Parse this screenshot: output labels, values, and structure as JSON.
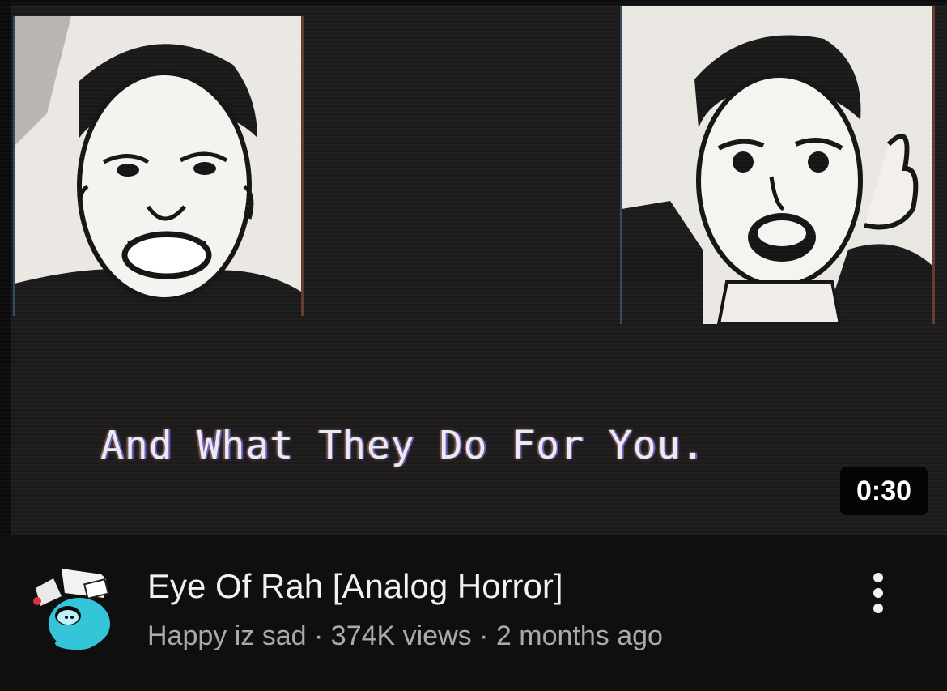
{
  "thumbnail": {
    "caption": "And What They Do For You.",
    "duration": "0:30"
  },
  "video": {
    "title": "Eye Of Rah [Analog Horror]",
    "channel": "Happy iz sad",
    "views": "374K views",
    "age": "2 months ago",
    "separator": "·"
  },
  "icons": {
    "menu": "more-vert-icon",
    "avatar": "channel-avatar-icon"
  },
  "colors": {
    "background": "#0f0f0f",
    "title": "#f1f1f1",
    "meta": "#aaaaaa",
    "duration_badge": "#000000",
    "avatar_accent": "#34c5d8"
  }
}
